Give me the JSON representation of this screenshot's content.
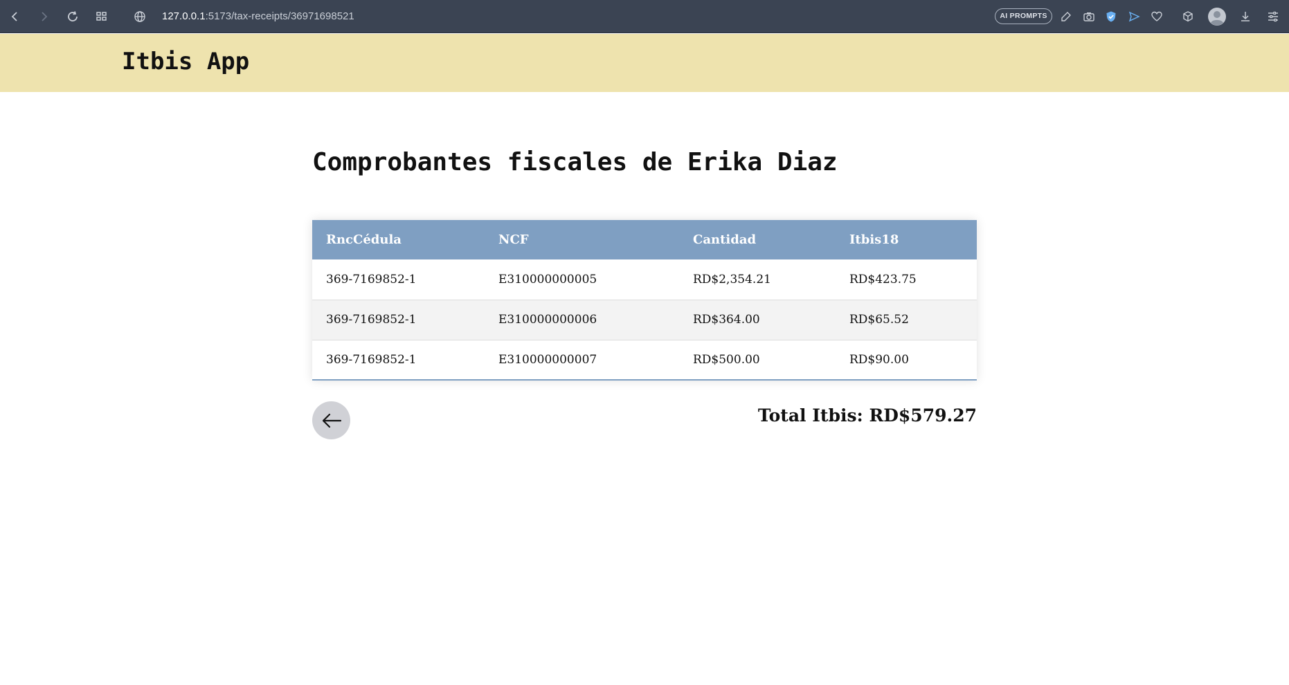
{
  "browser": {
    "url_host": "127.0.0.1",
    "url_rest": ":5173/tax-receipts/36971698521",
    "ai_prompts_label": "AI PROMPTS"
  },
  "app": {
    "title": "Itbis App"
  },
  "main": {
    "title": "Comprobantes fiscales de Erika Diaz",
    "table": {
      "headers": [
        "RncCédula",
        "NCF",
        "Cantidad",
        "Itbis18"
      ],
      "rows": [
        [
          "369-7169852-1",
          "E310000000005",
          "RD$2,354.21",
          "RD$423.75"
        ],
        [
          "369-7169852-1",
          "E310000000006",
          "RD$364.00",
          "RD$65.52"
        ],
        [
          "369-7169852-1",
          "E310000000007",
          "RD$500.00",
          "RD$90.00"
        ]
      ]
    },
    "total_label": "Total Itbis: RD$579.27"
  },
  "colors": {
    "chrome": "#3b4453",
    "header_bg": "#eee3ae",
    "table_header": "#7f9fc2"
  }
}
